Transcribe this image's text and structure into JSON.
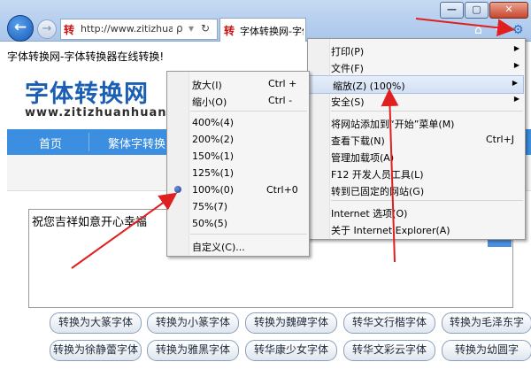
{
  "browser": {
    "address_badge": "转",
    "url": "http://www.zitizhua...",
    "tab_badge": "转",
    "tab_title": "字体转换网-字体转换器在...",
    "window_buttons": {
      "minimize": "—",
      "maximize": "▢",
      "close": "✕"
    },
    "icons": {
      "back": "←",
      "forward": "→",
      "search": "ρ",
      "refresh": "↻",
      "home": "⌂",
      "favorites": "★",
      "tools": "⚙"
    }
  },
  "page": {
    "tagline": "字体转换网-字体转换器在线转换!",
    "logo": "字体转换网",
    "logo_url": "www.zitizhuanhuan.co",
    "nav": [
      "首页",
      "繁体字转换"
    ],
    "textarea_text": "祝您吉祥如意开心幸福",
    "convert_buttons_row1": [
      "转换为大篆字体",
      "转换为小篆字体",
      "转换为魏碑字体",
      "转华文行楷字体",
      "转换为毛泽东字"
    ],
    "convert_buttons_row2": [
      "转换为徐静蕾字体",
      "转换为雅黑字体",
      "转华康少女字体",
      "转华文彩云字体",
      "转换为幼圆字"
    ]
  },
  "tools_menu": {
    "items": [
      {
        "label": "打印(P)",
        "submenu": true
      },
      {
        "label": "文件(F)",
        "submenu": true
      },
      {
        "label": "缩放(Z) (100%)",
        "submenu": true,
        "highlighted": true
      },
      {
        "label": "安全(S)",
        "submenu": true
      },
      {
        "label": "将网站添加到“开始”菜单(M)",
        "shortcut": ""
      },
      {
        "label": "查看下载(N)",
        "shortcut": "Ctrl+J"
      },
      {
        "label": "管理加载项(A)",
        "shortcut": ""
      },
      {
        "label": "F12 开发人员工具(L)",
        "shortcut": ""
      },
      {
        "label": "转到已固定的网站(G)",
        "shortcut": ""
      },
      {
        "label": "Internet 选项(O)",
        "shortcut": ""
      },
      {
        "label": "关于 Internet Explorer(A)",
        "shortcut": ""
      }
    ]
  },
  "zoom_menu": {
    "items": [
      {
        "label": "放大(I)",
        "shortcut": "Ctrl +"
      },
      {
        "label": "缩小(O)",
        "shortcut": "Ctrl -"
      },
      {
        "label": "400%(4)",
        "shortcut": ""
      },
      {
        "label": "200%(2)",
        "shortcut": ""
      },
      {
        "label": "150%(1)",
        "shortcut": ""
      },
      {
        "label": "125%(1)",
        "shortcut": ""
      },
      {
        "label": "100%(0)",
        "shortcut": "Ctrl+0",
        "selected": true
      },
      {
        "label": "75%(7)",
        "shortcut": ""
      },
      {
        "label": "50%(5)",
        "shortcut": ""
      },
      {
        "label": "自定义(C)...",
        "shortcut": ""
      }
    ]
  },
  "colors": {
    "annotation_arrow": "#e02020",
    "nav_bar": "#3b8ee0",
    "logo": "#1a5fb4"
  }
}
